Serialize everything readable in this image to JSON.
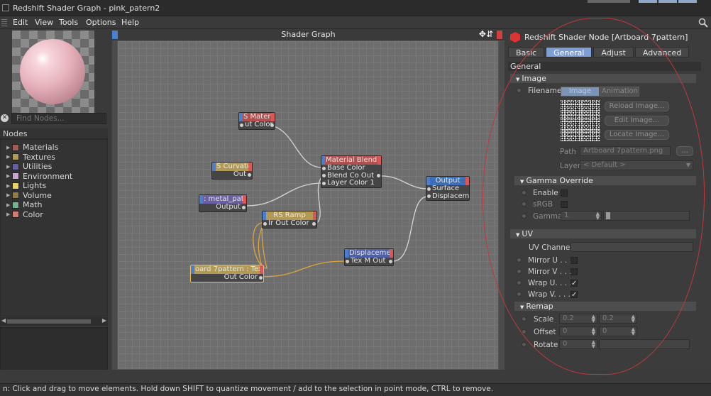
{
  "window": {
    "title": "Redshift Shader Graph - pink_patern2"
  },
  "menu": [
    "Edit",
    "View",
    "Tools",
    "Options",
    "Help"
  ],
  "left": {
    "find_placeholder": "Find Nodes...",
    "nodes_header": "Nodes",
    "categories": [
      {
        "label": "Materials",
        "color": "#a45a57"
      },
      {
        "label": "Textures",
        "color": "#b29a55"
      },
      {
        "label": "Utilities",
        "color": "#6a5fa5"
      },
      {
        "label": "Environment",
        "color": "#c9a8cf"
      },
      {
        "label": "Lights",
        "color": "#e6d170"
      },
      {
        "label": "Volume",
        "color": "#8d7f45"
      },
      {
        "label": "Math",
        "color": "#77b48b"
      },
      {
        "label": "Color",
        "color": "#d07a72"
      }
    ]
  },
  "graph": {
    "title": "Shader Graph",
    "nodes": {
      "material": {
        "title": "S Materi",
        "rows": [
          "ut Color"
        ]
      },
      "curvature": {
        "title": "S Curvatu",
        "rows": [
          "Out"
        ]
      },
      "metal": {
        "title": ": metal_pat",
        "rows": [
          "Output"
        ]
      },
      "blend": {
        "title": "Material Blend",
        "rows": [
          "Base Color",
          "Blend Co  Out",
          "Layer Color 1"
        ]
      },
      "ramp": {
        "title": "RS Ramp",
        "rows": [
          "Ir Out Color"
        ]
      },
      "output": {
        "title": "Output",
        "rows": [
          "Surface",
          "Displacem"
        ]
      },
      "displace": {
        "title": "Displaceme",
        "rows": [
          "Tex M Out"
        ]
      },
      "texture": {
        "title": "oard 7pattern : Tex",
        "rows": [
          "Out Color"
        ]
      }
    }
  },
  "props": {
    "title": "Redshift Shader Node [Artboard 7pattern]",
    "tabs": [
      {
        "label": "Basic",
        "active": false
      },
      {
        "label": "General",
        "active": true
      },
      {
        "label": "Adjust",
        "active": false
      },
      {
        "label": "Advanced",
        "active": false
      }
    ],
    "section": "General",
    "image": {
      "group": "Image",
      "filename_label": "Filename",
      "image_btn": "Image",
      "animation_btn": "Animation",
      "reload": "Reload Image...",
      "edit": "Edit Image...",
      "locate": "Locate Image...",
      "path_label": "Path",
      "path_value": "Artboard 7pattern.png",
      "browse": "...",
      "layer_label": "Layer",
      "layer_value": "< Default >"
    },
    "gamma": {
      "group": "Gamma Override",
      "enable": "Enable",
      "srgb": "sRGB",
      "gamma": "Gamma",
      "gamma_value": "1",
      "gamma_slider_fraction": 0.03
    },
    "uv": {
      "group": "UV",
      "channel": "UV Channel",
      "mirror_u": "Mirror U . . .",
      "mirror_v": "Mirror V . . .",
      "wrap_u": "Wrap U. . . .",
      "wrap_v": "Wrap V. . . .",
      "wrap_u_checked": true,
      "wrap_v_checked": true
    },
    "remap": {
      "group": "Remap",
      "scale": "Scale",
      "scale_x": "0.2",
      "scale_y": "0.2",
      "offset": "Offset",
      "offset_x": "0",
      "offset_y": "0",
      "rotate": "Rotate",
      "rotate_value": "0"
    }
  },
  "status": "n: Click and drag to move elements. Hold down SHIFT to quantize movement / add to the selection in point mode, CTRL to remove.",
  "colors": {
    "accent": "#7d9fd4",
    "annotation": "#c0393b",
    "wire": "#d0d0d0",
    "wire_selected": "#e0a53a"
  }
}
